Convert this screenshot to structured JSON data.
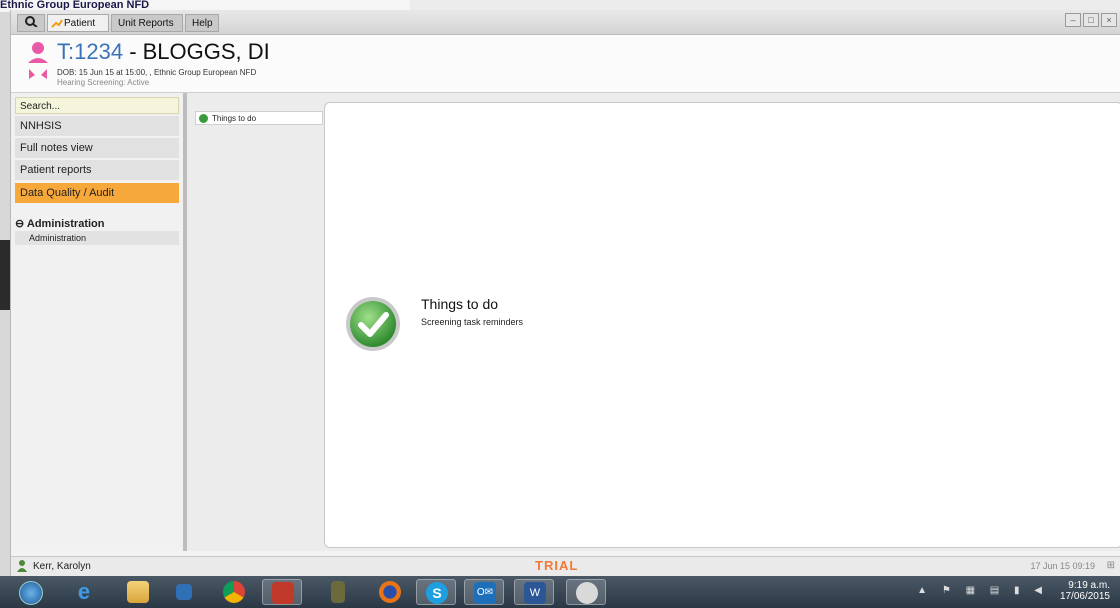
{
  "background": {
    "title": "Ethnic Group European NFD"
  },
  "menubar": {
    "tabs": [
      "Patient",
      "Unit Reports",
      "Help"
    ]
  },
  "header": {
    "patient_id": "T:1234",
    "patient_name": "- BLOGGS, DI",
    "dob_line": "DOB: 15 Jun 15 at 15:00, , Ethnic Group European NFD",
    "hearing": "Hearing Screening: Active"
  },
  "sidebar": {
    "search_placeholder": "Search...",
    "items": [
      {
        "label": "NNHSIS"
      },
      {
        "label": "Full notes view"
      },
      {
        "label": "Patient reports"
      },
      {
        "label": "Data Quality / Audit",
        "selected": true
      }
    ],
    "group_label": "Administration",
    "group_item": "Administration"
  },
  "content": {
    "tab_label": "Things to do",
    "title": "Things to do",
    "subtitle": "Screening task reminders"
  },
  "status": {
    "user": "Kerr, Karolyn",
    "trial": "TRIAL",
    "timestamp": "17 Jun 15 09:19"
  },
  "taskbar": {
    "time": "9:19 a.m.",
    "date": "17/06/2015",
    "apps": [
      "windows-start",
      "internet-explorer",
      "file-explorer",
      "media-player",
      "chrome",
      "nnhsis-app",
      "keypass",
      "firefox",
      "skype",
      "outlook",
      "word",
      "nnhsis-app-2"
    ]
  },
  "colors": {
    "accent": "#f7a83b",
    "id_blue": "#3a73b8",
    "trial": "#f07a3a"
  }
}
